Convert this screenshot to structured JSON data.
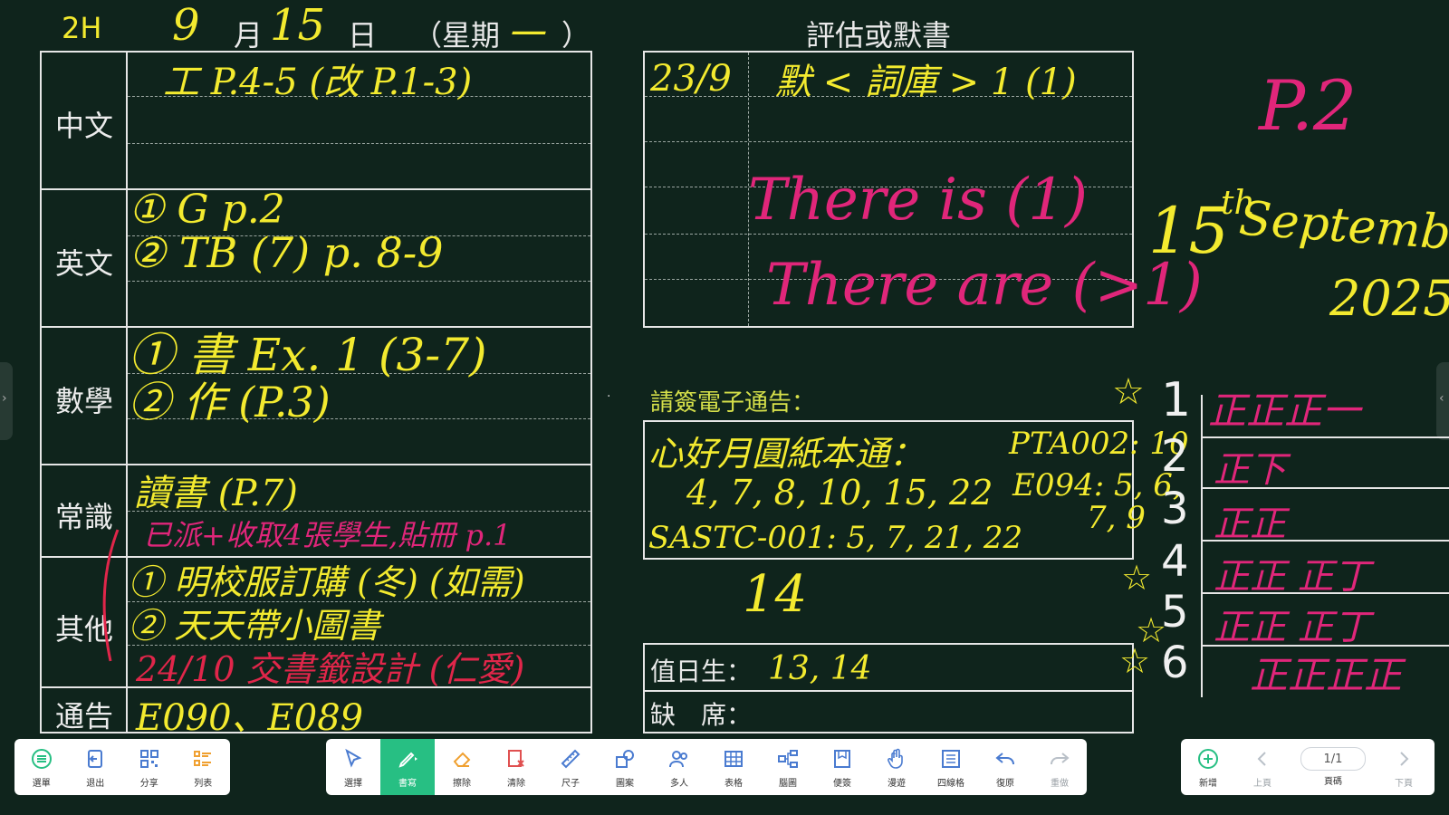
{
  "header": {
    "class_label": "2H",
    "day_month": "9",
    "month_char": "月",
    "date_num": "15",
    "day_char": "日",
    "weekday": "（星期",
    "weekday_value": "一",
    "weekday_close": "）",
    "assessment_title": "評估或默書"
  },
  "subjects": {
    "chinese": "中文",
    "english": "英文",
    "math": "數學",
    "general": "常識",
    "others": "其他",
    "notice": "通告"
  },
  "homework": {
    "chinese_line1": "工 P.4-5 (改 P.1-3)",
    "english_line1": "① G p.2",
    "english_line2": "② TB (7) p. 8-9",
    "math_line1": "① 書 Ex. 1 (3-7)",
    "math_line2": "② 作 (P.3)",
    "general_line1": "讀書 (P.7)",
    "general_note": "已派+收取4張學生,貼冊 p.1",
    "others_line1": "① 明校服訂購 (冬) (如需)",
    "others_line2": "② 天天帶小圖書",
    "others_line3": "24/10 交書籤設計 (仁愛)",
    "notice_line1": "E090、E089"
  },
  "assessment": {
    "date": "23/9",
    "item": "默 < 詞庫 > 1 (1)",
    "grammar1": "There is (1)",
    "grammar2": "There are (>1)"
  },
  "notice_section": {
    "title": "請簽電子通告：",
    "line1": "心好月圓紙本通：",
    "line2": "4, 7, 8, 10, 15, 22",
    "line3": "SASTC-001: 5, 7, 21, 22",
    "pta_line": "PTA002: 10",
    "e094_line": "E094: 5, 6,",
    "e094_line2": "7, 9",
    "below_number": "14"
  },
  "duty": {
    "label": "值日生：",
    "value": "13, 14",
    "absent_label": "缺　席："
  },
  "right_panel": {
    "page_note": "P.2",
    "date_day": "15",
    "date_sup": "th",
    "date_month": "September,",
    "date_year": "2025",
    "tally_rows": [
      {
        "num": "1",
        "tally": "正正正一"
      },
      {
        "num": "2",
        "tally": "正下"
      },
      {
        "num": "3",
        "tally": "正正"
      },
      {
        "num": "4",
        "tally": "正正 正丁"
      },
      {
        "num": "5",
        "tally": "正正 正丁"
      },
      {
        "num": "6",
        "tally": "正正正正"
      }
    ]
  },
  "toolbar_left": [
    {
      "label": "選單",
      "icon": "menu-icon"
    },
    {
      "label": "退出",
      "icon": "exit-icon"
    },
    {
      "label": "分享",
      "icon": "qr-share-icon"
    },
    {
      "label": "列表",
      "icon": "list-icon"
    }
  ],
  "toolbar_center": [
    {
      "label": "選擇",
      "icon": "cursor-icon"
    },
    {
      "label": "書寫",
      "icon": "pen-icon"
    },
    {
      "label": "擦除",
      "icon": "eraser-icon"
    },
    {
      "label": "清除",
      "icon": "clear-icon"
    },
    {
      "label": "尺子",
      "icon": "ruler-icon"
    },
    {
      "label": "圖案",
      "icon": "shapes-icon"
    },
    {
      "label": "多人",
      "icon": "multi-user-icon"
    },
    {
      "label": "表格",
      "icon": "table-icon"
    },
    {
      "label": "腦圖",
      "icon": "mindmap-icon"
    },
    {
      "label": "便簽",
      "icon": "sticky-note-icon"
    },
    {
      "label": "漫遊",
      "icon": "hand-pan-icon"
    },
    {
      "label": "四線格",
      "icon": "four-line-icon"
    },
    {
      "label": "復原",
      "icon": "undo-icon"
    },
    {
      "label": "重做",
      "icon": "redo-icon"
    }
  ],
  "toolbar_right": {
    "add_label": "新增",
    "prev_label": "上頁",
    "page_indicator": "1/1",
    "pages_label": "頁碼",
    "next_label": "下頁"
  },
  "colors": {
    "board": "#0f241c",
    "chalk_yellow": "#f3ea2f",
    "chalk_pink": "#e0267a",
    "chalk_red": "#e0264a",
    "active_tool": "#27bf83",
    "icon_blue": "#4a7bd0"
  }
}
